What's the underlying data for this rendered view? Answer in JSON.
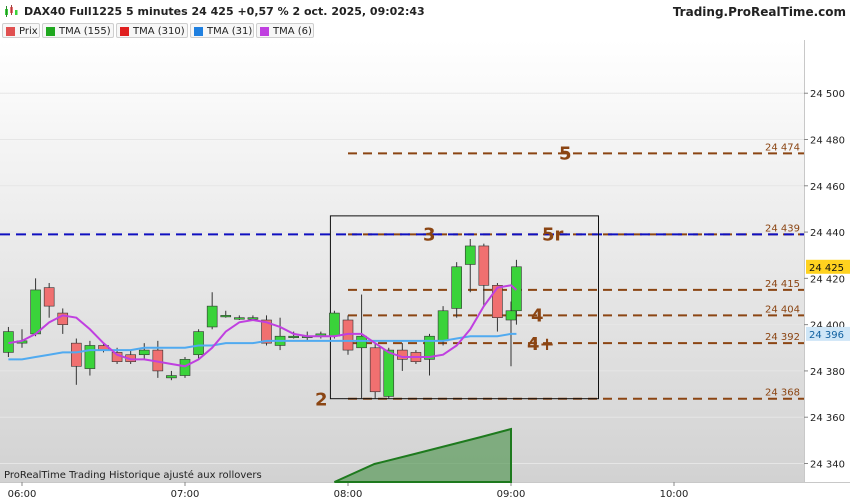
{
  "header": {
    "title": "DAX40 Full1225 5 minutes 24 425 +0,57 % 2 oct. 2025, 09:02:43",
    "brand": "Trading.ProRealTime.com"
  },
  "legend": [
    {
      "label": "Prix",
      "color": "#e05050"
    },
    {
      "label": "TMA (155)",
      "color": "#1fa81f"
    },
    {
      "label": "TMA (310)",
      "color": "#e02020"
    },
    {
      "label": "TMA (31)",
      "color": "#2080e0"
    },
    {
      "label": "TMA (6)",
      "color": "#c040e0"
    }
  ],
  "footer_note": "ProRealTime Trading  Historique ajusté aux rollovers",
  "colors": {
    "bull": "#3ad33a",
    "bear": "#f07070",
    "tma31": "#50aaf0",
    "tma6": "#c040e0",
    "level_line": "#8b4513",
    "annotation": "#8b4513",
    "blue_dash": "#1010c0",
    "volume_fill": "#5a9a5a"
  },
  "annotations": {
    "label_2": "2",
    "label_3": "3",
    "label_4": "4",
    "label_4plus": "4+",
    "label_5": "5",
    "label_5r": "5r"
  },
  "chart_data": {
    "type": "candlestick",
    "timeframe": "5 minutes",
    "ylim": [
      24332,
      24523
    ],
    "y_ticks": [
      24340,
      24360,
      24380,
      24400,
      24420,
      24440,
      24460,
      24480,
      24500
    ],
    "y_tick_labels": [
      "24 340",
      "24 360",
      "24 380",
      "24 400",
      "24 420",
      "24 440",
      "24 460",
      "24 480",
      "24 500"
    ],
    "x_ticks": [
      "06:00",
      "07:00",
      "08:00",
      "09:00",
      "10:00"
    ],
    "last_price": 24425,
    "last_price_label": "24 425",
    "tma31_last": 24396,
    "tma31_last_label": "24 396",
    "blue_line": 24439,
    "levels": [
      {
        "value": 24474,
        "label": "24 474"
      },
      {
        "value": 24439,
        "label": "24 439"
      },
      {
        "value": 24415,
        "label": "24 415"
      },
      {
        "value": 24404,
        "label": "24 404"
      },
      {
        "value": 24392,
        "label": "24 392"
      },
      {
        "value": 24368,
        "label": "24 368"
      }
    ],
    "candles": [
      {
        "time": "05:55",
        "o": 24388,
        "h": 24399,
        "l": 24386,
        "c": 24397
      },
      {
        "time": "06:00",
        "o": 24392,
        "h": 24398,
        "l": 24390,
        "c": 24393
      },
      {
        "time": "06:05",
        "o": 24396,
        "h": 24420,
        "l": 24395,
        "c": 24415
      },
      {
        "time": "06:10",
        "o": 24416,
        "h": 24418,
        "l": 24403,
        "c": 24408
      },
      {
        "time": "06:15",
        "o": 24405,
        "h": 24407,
        "l": 24396,
        "c": 24400
      },
      {
        "time": "06:20",
        "o": 24392,
        "h": 24394,
        "l": 24374,
        "c": 24382
      },
      {
        "time": "06:25",
        "o": 24381,
        "h": 24393,
        "l": 24378,
        "c": 24391
      },
      {
        "time": "06:30",
        "o": 24391,
        "h": 24392,
        "l": 24388,
        "c": 24389
      },
      {
        "time": "06:35",
        "o": 24388,
        "h": 24390,
        "l": 24383,
        "c": 24384
      },
      {
        "time": "06:40",
        "o": 24387,
        "h": 24389,
        "l": 24383,
        "c": 24384
      },
      {
        "time": "06:45",
        "o": 24387,
        "h": 24392,
        "l": 24385,
        "c": 24389
      },
      {
        "time": "06:50",
        "o": 24389,
        "h": 24393,
        "l": 24377,
        "c": 24380
      },
      {
        "time": "06:55",
        "o": 24377,
        "h": 24380,
        "l": 24376,
        "c": 24378
      },
      {
        "time": "07:00",
        "o": 24378,
        "h": 24386,
        "l": 24377,
        "c": 24385
      },
      {
        "time": "07:05",
        "o": 24387,
        "h": 24398,
        "l": 24385,
        "c": 24397
      },
      {
        "time": "07:10",
        "o": 24399,
        "h": 24414,
        "l": 24398,
        "c": 24408
      },
      {
        "time": "07:15",
        "o": 24404,
        "h": 24406,
        "l": 24403,
        "c": 24404
      },
      {
        "time": "07:20",
        "o": 24403,
        "h": 24404,
        "l": 24402,
        "c": 24403
      },
      {
        "time": "07:25",
        "o": 24403,
        "h": 24404,
        "l": 24402,
        "c": 24403
      },
      {
        "time": "07:30",
        "o": 24402,
        "h": 24404,
        "l": 24391,
        "c": 24392
      },
      {
        "time": "07:35",
        "o": 24391,
        "h": 24403,
        "l": 24389,
        "c": 24395
      },
      {
        "time": "07:40",
        "o": 24395,
        "h": 24397,
        "l": 24394,
        "c": 24395
      },
      {
        "time": "07:45",
        "o": 24395,
        "h": 24397,
        "l": 24393,
        "c": 24395
      },
      {
        "time": "07:50",
        "o": 24395,
        "h": 24397,
        "l": 24394,
        "c": 24396
      },
      {
        "time": "07:55",
        "o": 24395,
        "h": 24406,
        "l": 24394,
        "c": 24405
      },
      {
        "time": "08:00",
        "o": 24402,
        "h": 24404,
        "l": 24387,
        "c": 24389
      },
      {
        "time": "08:05",
        "o": 24390,
        "h": 24413,
        "l": 24368,
        "c": 24395
      },
      {
        "time": "08:10",
        "o": 24390,
        "h": 24392,
        "l": 24368,
        "c": 24371
      },
      {
        "time": "08:15",
        "o": 24369,
        "h": 24390,
        "l": 24368,
        "c": 24389
      },
      {
        "time": "08:20",
        "o": 24389,
        "h": 24392,
        "l": 24380,
        "c": 24385
      },
      {
        "time": "08:25",
        "o": 24388,
        "h": 24389,
        "l": 24383,
        "c": 24384
      },
      {
        "time": "08:30",
        "o": 24385,
        "h": 24396,
        "l": 24378,
        "c": 24395
      },
      {
        "time": "08:35",
        "o": 24393,
        "h": 24408,
        "l": 24391,
        "c": 24406
      },
      {
        "time": "08:40",
        "o": 24407,
        "h": 24427,
        "l": 24403,
        "c": 24425
      },
      {
        "time": "08:45",
        "o": 24426,
        "h": 24437,
        "l": 24414,
        "c": 24434
      },
      {
        "time": "08:50",
        "o": 24434,
        "h": 24435,
        "l": 24408,
        "c": 24417
      },
      {
        "time": "08:55",
        "o": 24417,
        "h": 24418,
        "l": 24397,
        "c": 24403
      },
      {
        "time": "09:00",
        "o": 24402,
        "h": 24410,
        "l": 24382,
        "c": 24406
      },
      {
        "time": "09:02",
        "o": 24406,
        "h": 24428,
        "l": 24400,
        "c": 24425
      }
    ],
    "tma31": [
      24385,
      24385,
      24386,
      24387,
      24388,
      24388,
      24389,
      24389,
      24389,
      24389,
      24390,
      24390,
      24390,
      24390,
      24391,
      24391,
      24392,
      24392,
      24392,
      24393,
      24393,
      24393,
      24393,
      24393,
      24393,
      24393,
      24393,
      24393,
      24393,
      24393,
      24393,
      24393,
      24393,
      24394,
      24395,
      24395,
      24395,
      24396,
      24396
    ],
    "tma6": [
      24392,
      24393,
      24396,
      24401,
      24404,
      24403,
      24398,
      24392,
      24387,
      24385,
      24385,
      24384,
      24383,
      24382,
      24385,
      24390,
      24397,
      24401,
      24402,
      24401,
      24399,
      24396,
      24395,
      24395,
      24395,
      24396,
      24396,
      24392,
      24388,
      24386,
      24386,
      24386,
      24387,
      24391,
      24398,
      24408,
      24416,
      24417,
      24415
    ]
  }
}
